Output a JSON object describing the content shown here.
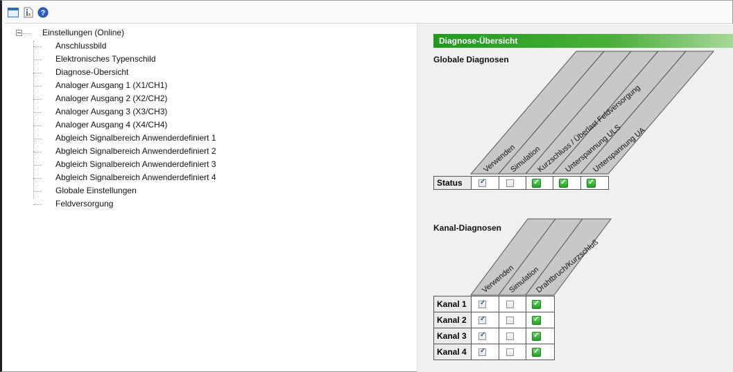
{
  "toolbar": {
    "icons": [
      "window-icon",
      "info-icon",
      "help-icon"
    ]
  },
  "tree": {
    "root_label": "Einstellungen (Online)",
    "items": [
      "Anschlussbild",
      "Elektronisches Typenschild",
      "Diagnose-Übersicht",
      "Analoger Ausgang 1 (X1/CH1)",
      "Analoger Ausgang 2 (X2/CH2)",
      "Analoger Ausgang 3 (X3/CH3)",
      "Analoger Ausgang 4 (X4/CH4)",
      "Abgleich Signalbereich Anwenderdefiniert 1",
      "Abgleich Signalbereich Anwenderdefiniert 2",
      "Abgleich Signalbereich Anwenderdefiniert 3",
      "Abgleich Signalbereich Anwenderdefiniert 4",
      "Globale Einstellungen",
      "Feldversorgung"
    ],
    "selected": "Diagnose-Übersicht"
  },
  "panel": {
    "title": "Diagnose-Übersicht",
    "global": {
      "title": "Globale Diagnosen",
      "headers": [
        "Verwenden",
        "Simulation",
        "Kurzschluss / Überlast Feldversorgung",
        "Unterspannung ULS",
        "Unterspannung UA"
      ],
      "row_label": "Status",
      "cells": [
        "checked",
        "unchecked",
        "ok",
        "ok",
        "ok"
      ]
    },
    "channel": {
      "title": "Kanal-Diagnosen",
      "headers": [
        "Verwenden",
        "Simulation",
        "Drahtbruch/Kurzschluß"
      ],
      "rows": [
        {
          "label": "Kanal 1",
          "cells": [
            "checked",
            "unchecked",
            "ok"
          ]
        },
        {
          "label": "Kanal 2",
          "cells": [
            "checked",
            "unchecked",
            "ok"
          ]
        },
        {
          "label": "Kanal 3",
          "cells": [
            "checked",
            "unchecked",
            "ok"
          ]
        },
        {
          "label": "Kanal 4",
          "cells": [
            "checked",
            "unchecked",
            "ok"
          ]
        }
      ]
    }
  },
  "colors": {
    "title_bar": "#1e9a1e",
    "header_fill": "#c8c8c8",
    "ok_green": "#26a126"
  }
}
